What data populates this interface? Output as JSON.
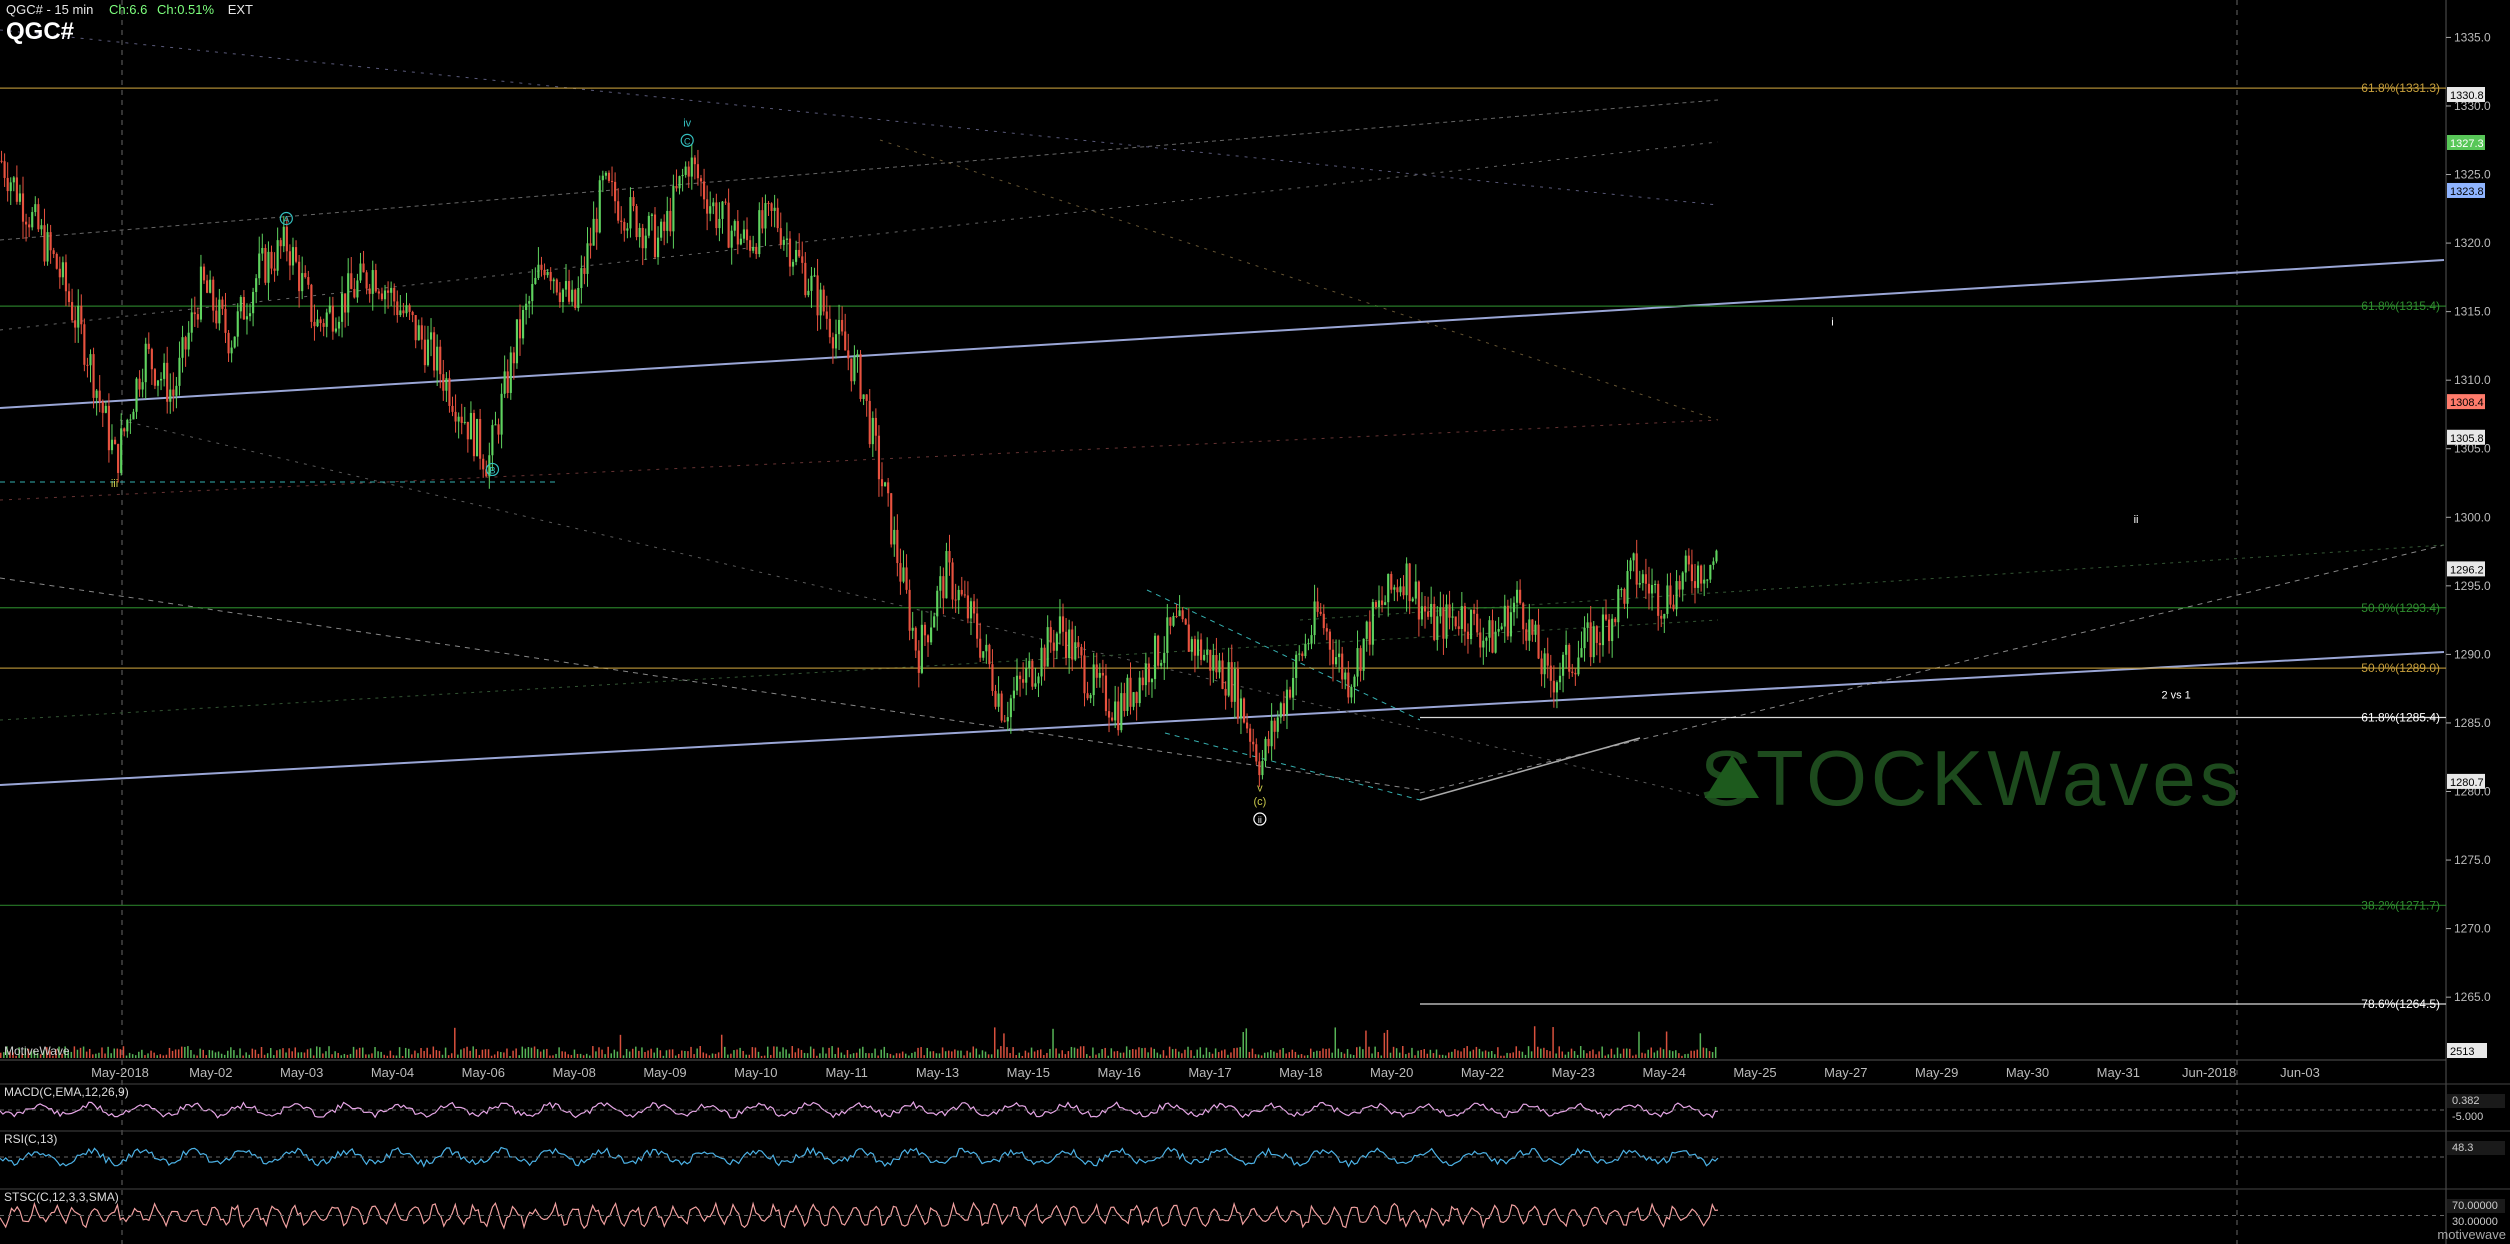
{
  "header": {
    "title": "QGC# - 15 min",
    "change": "Ch:6.6",
    "change_pct": "Ch:0.51%",
    "session": "EXT",
    "symbol": "QGC#"
  },
  "footer_brand": "motivewave",
  "chart_data": {
    "type": "line",
    "subtype": "candlestick",
    "y_axis": {
      "min": 1261,
      "max": 1337,
      "ticks": [
        1265,
        1270,
        1275,
        1280,
        1285,
        1290,
        1295,
        1300,
        1305,
        1310,
        1315,
        1320,
        1325,
        1330,
        1335
      ]
    },
    "x_labels": [
      "May-2018",
      "May-02",
      "May-03",
      "May-04",
      "May-06",
      "May-08",
      "May-09",
      "May-10",
      "May-11",
      "May-13",
      "May-15",
      "May-16",
      "May-17",
      "May-18",
      "May-20",
      "May-22",
      "May-23",
      "May-24",
      "May-25",
      "May-27",
      "May-29",
      "May-30",
      "May-31",
      "Jun-2018",
      "Jun-03"
    ],
    "price_path": [
      [
        0,
        1326
      ],
      [
        0.5,
        1322
      ],
      [
        1,
        1318
      ],
      [
        1.5,
        1312
      ],
      [
        2,
        1304
      ],
      [
        2.5,
        1312
      ],
      [
        3,
        1309
      ],
      [
        3.5,
        1317
      ],
      [
        4,
        1313
      ],
      [
        4.5,
        1318
      ],
      [
        5,
        1320
      ],
      [
        5.5,
        1314
      ],
      [
        6,
        1316
      ],
      [
        6.5,
        1318
      ],
      [
        7,
        1315
      ],
      [
        7.5,
        1312
      ],
      [
        8,
        1308
      ],
      [
        8.5,
        1304
      ],
      [
        9,
        1313
      ],
      [
        9.5,
        1319
      ],
      [
        10,
        1315
      ],
      [
        10.5,
        1324
      ],
      [
        11,
        1322
      ],
      [
        11.5,
        1320
      ],
      [
        12,
        1326
      ],
      [
        12.5,
        1322
      ],
      [
        13,
        1320
      ],
      [
        13.5,
        1322
      ],
      [
        14,
        1318
      ],
      [
        14.5,
        1314
      ],
      [
        15,
        1310
      ],
      [
        15.5,
        1300
      ],
      [
        16,
        1290
      ],
      [
        16.5,
        1296
      ],
      [
        17,
        1292
      ],
      [
        17.5,
        1286
      ],
      [
        18,
        1289
      ],
      [
        18.5,
        1292
      ],
      [
        19,
        1288
      ],
      [
        19.5,
        1286
      ],
      [
        20,
        1289
      ],
      [
        20.5,
        1292
      ],
      [
        21,
        1290
      ],
      [
        21.5,
        1288
      ],
      [
        22,
        1282
      ],
      [
        22.5,
        1288
      ],
      [
        23,
        1293
      ],
      [
        23.5,
        1288
      ],
      [
        24,
        1293
      ],
      [
        24.5,
        1296
      ],
      [
        25,
        1292
      ],
      [
        25.5,
        1293
      ],
      [
        26,
        1291
      ],
      [
        26.5,
        1294
      ],
      [
        27,
        1288
      ],
      [
        27.5,
        1290
      ],
      [
        28,
        1292
      ],
      [
        28.5,
        1296
      ],
      [
        29,
        1294
      ],
      [
        29.5,
        1296
      ],
      [
        30,
        1297
      ]
    ],
    "price_labels": [
      {
        "text": "1330.8",
        "value": 1330.8,
        "bg": "#e8e8e8",
        "fg": "#000000"
      },
      {
        "text": "1327.3",
        "value": 1327.3,
        "bg": "#58c758",
        "fg": "#ffffff"
      },
      {
        "text": "1323.8",
        "value": 1323.8,
        "bg": "#8fb4ff",
        "fg": "#000000"
      },
      {
        "text": "1308.4",
        "value": 1308.4,
        "bg": "#ff7b6b",
        "fg": "#000000"
      },
      {
        "text": "1305.8",
        "value": 1305.8,
        "bg": "#e8e8e8",
        "fg": "#000000"
      },
      {
        "text": "1296.2",
        "value": 1296.2,
        "bg": "#e8e8e8",
        "fg": "#000000"
      },
      {
        "text": "1280.7",
        "value": 1280.7,
        "bg": "#e8e8e8",
        "fg": "#000000"
      }
    ],
    "fib_levels": [
      {
        "text": "61.8%(1331.3)",
        "value": 1331.3,
        "color": "#c8a03c"
      },
      {
        "text": "61.8%(1315.4)",
        "value": 1315.4,
        "color": "#2f8f2f"
      },
      {
        "text": "50.0%(1293.4)",
        "value": 1293.4,
        "color": "#2f8f2f"
      },
      {
        "text": "50.0%(1289.0)",
        "value": 1289.0,
        "color": "#c8a03c"
      },
      {
        "text": "61.8%(1285.4)",
        "value": 1285.4,
        "color": "#ffffff"
      },
      {
        "text": "38.2%(1271.7)",
        "value": 1271.7,
        "color": "#2f8f2f"
      },
      {
        "text": "78.6%(1264.5)",
        "value": 1264.5,
        "color": "#ffffff"
      }
    ],
    "annotations": [
      {
        "text": "iii",
        "x": 2,
        "value": 1302.2,
        "color": "#c8c84a"
      },
      {
        "text": "A",
        "x": 5,
        "value": 1321.5,
        "color": "#35c0c0",
        "circle": true
      },
      {
        "text": "B",
        "x": 8.6,
        "value": 1303.2,
        "color": "#35c0c0",
        "circle": true
      },
      {
        "text": "iv",
        "x": 12,
        "value": 1328.5,
        "color": "#35c0c0"
      },
      {
        "text": "C",
        "x": 12,
        "value": 1327.2,
        "color": "#35c0c0",
        "circle": true
      },
      {
        "text": "v",
        "x": 22,
        "value": 1280.0,
        "color": "#c8c84a"
      },
      {
        "text": "(c)",
        "x": 22,
        "value": 1279.0,
        "color": "#c8c84a"
      },
      {
        "text": "ii",
        "x": 22,
        "value": 1277.7,
        "color": "#ffffff",
        "circle": true
      },
      {
        "text": "i",
        "x": 32,
        "value": 1314.0,
        "color": "#ffffff"
      },
      {
        "text": "ii",
        "x": 37.3,
        "value": 1299.6,
        "color": "#ffffff"
      },
      {
        "text": "2 vs 1",
        "x": 38,
        "value": 1286.8,
        "color": "#ffffff"
      }
    ],
    "volume_label": "MotiveWave",
    "volume_value": "2513",
    "indicators": [
      {
        "name": "MACD(C,EMA,12,26,9)",
        "values": [
          "0.382",
          "-5.000"
        ]
      },
      {
        "name": "RSI(C,13)",
        "values": [
          "48.3"
        ]
      },
      {
        "name": "STSC(C,12,3,3,SMA)",
        "values": [
          "70.00000",
          "30.00000"
        ]
      }
    ],
    "watermark": "STOCKWaves"
  }
}
